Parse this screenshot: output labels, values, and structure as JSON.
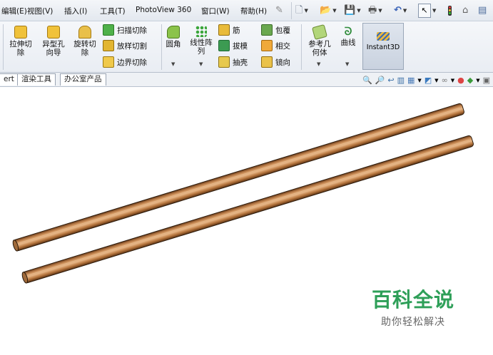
{
  "menu": {
    "items": [
      "编辑(E)",
      "视图(V)",
      "插入(I)",
      "工具(T)",
      "PhotoView 360",
      "窗口(W)",
      "帮助(H)"
    ]
  },
  "ribbon": {
    "cut_extrude": "拉伸切\n除",
    "hole_wizard": "异型孔\n向导",
    "revolve_cut": "旋转切\n除",
    "swept_cut": "扫描切除",
    "lofted_cut": "放样切割",
    "boundary_cut": "边界切除",
    "fillet": "圆角",
    "linear_pattern": "线性阵\n列",
    "rib": "筋",
    "draft": "拔模",
    "shell": "抽壳",
    "wrap": "包覆",
    "intersect": "相交",
    "mirror": "镜向",
    "ref_geometry": "参考几\n何体",
    "curves": "曲线",
    "instant3d": "Instant3D"
  },
  "tabs": [
    "ert",
    "渲染工具",
    "办公室产品"
  ],
  "watermark": {
    "title": "百科全说",
    "subtitle": "助你轻松解决"
  },
  "colors": {
    "accent_green": "#2e9f58",
    "rod_light": "#e9b98a",
    "rod_dark": "#6b3a17"
  }
}
